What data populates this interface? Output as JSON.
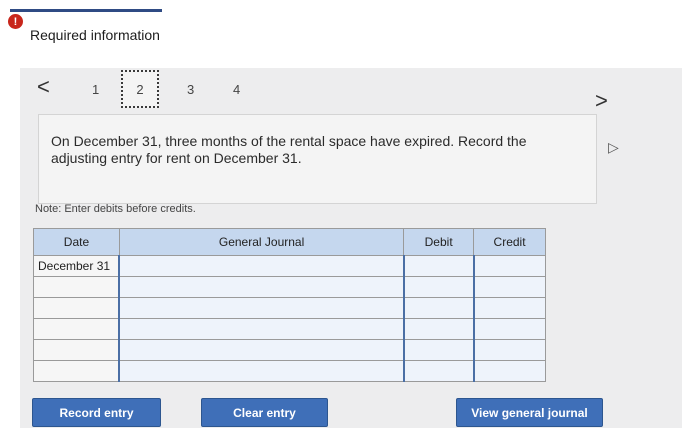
{
  "header": {
    "alert_symbol": "!",
    "title": "Required information"
  },
  "navigation": {
    "prev_symbol": "<",
    "next_symbol": ">",
    "steps": [
      "1",
      "2",
      "3",
      "4"
    ],
    "active_step": "2"
  },
  "question": {
    "text": "On December 31, three months of the rental space have expired. Record the adjusting entry for rent on December 31."
  },
  "note": "Note: Enter debits before credits.",
  "journal": {
    "columns": [
      "Date",
      "General Journal",
      "Debit",
      "Credit"
    ],
    "rows": [
      {
        "date": "December 31",
        "account": "",
        "debit": "",
        "credit": ""
      },
      {
        "date": "",
        "account": "",
        "debit": "",
        "credit": ""
      },
      {
        "date": "",
        "account": "",
        "debit": "",
        "credit": ""
      },
      {
        "date": "",
        "account": "",
        "debit": "",
        "credit": ""
      },
      {
        "date": "",
        "account": "",
        "debit": "",
        "credit": ""
      },
      {
        "date": "",
        "account": "",
        "debit": "",
        "credit": ""
      }
    ]
  },
  "buttons": {
    "record": "Record entry",
    "clear": "Clear entry",
    "view": "View general journal"
  },
  "colors": {
    "accent": "#3f6fb8",
    "header_fill": "#c5d7ee",
    "alert": "#c8261b"
  }
}
